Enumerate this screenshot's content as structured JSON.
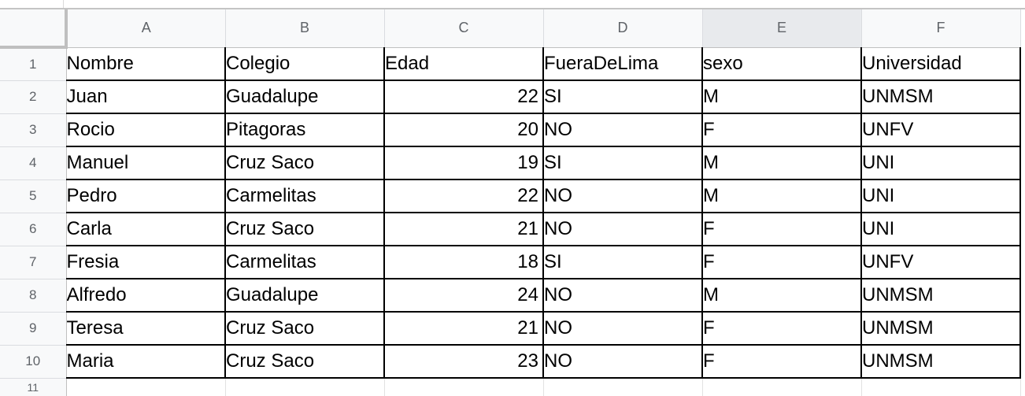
{
  "columns": [
    "A",
    "B",
    "C",
    "D",
    "E",
    "F"
  ],
  "rows": [
    {
      "num": "1",
      "cells": [
        "Nombre",
        "Colegio",
        "Edad",
        "FueraDeLima",
        "sexo",
        "Universidad"
      ]
    },
    {
      "num": "2",
      "cells": [
        "Juan",
        "Guadalupe",
        "22",
        "SI",
        "M",
        "UNMSM"
      ]
    },
    {
      "num": "3",
      "cells": [
        "Rocio",
        "Pitagoras",
        "20",
        "NO",
        "F",
        "UNFV"
      ]
    },
    {
      "num": "4",
      "cells": [
        "Manuel",
        "Cruz Saco",
        "19",
        "SI",
        "M",
        "UNI"
      ]
    },
    {
      "num": "5",
      "cells": [
        "Pedro",
        "Carmelitas",
        "22",
        "NO",
        "M",
        "UNI"
      ]
    },
    {
      "num": "6",
      "cells": [
        "Carla",
        "Cruz Saco",
        "21",
        "NO",
        "F",
        "UNI"
      ]
    },
    {
      "num": "7",
      "cells": [
        "Fresia",
        "Carmelitas",
        "18",
        "SI",
        "F",
        "UNFV"
      ]
    },
    {
      "num": "8",
      "cells": [
        "Alfredo",
        "Guadalupe",
        "24",
        "NO",
        "M",
        "UNMSM"
      ]
    },
    {
      "num": "9",
      "cells": [
        "Teresa",
        "Cruz Saco",
        "21",
        "NO",
        "F",
        "UNMSM"
      ]
    },
    {
      "num": "10",
      "cells": [
        "Maria",
        "Cruz Saco",
        "23",
        "NO",
        "F",
        "UNMSM"
      ]
    }
  ],
  "next_row": "11"
}
